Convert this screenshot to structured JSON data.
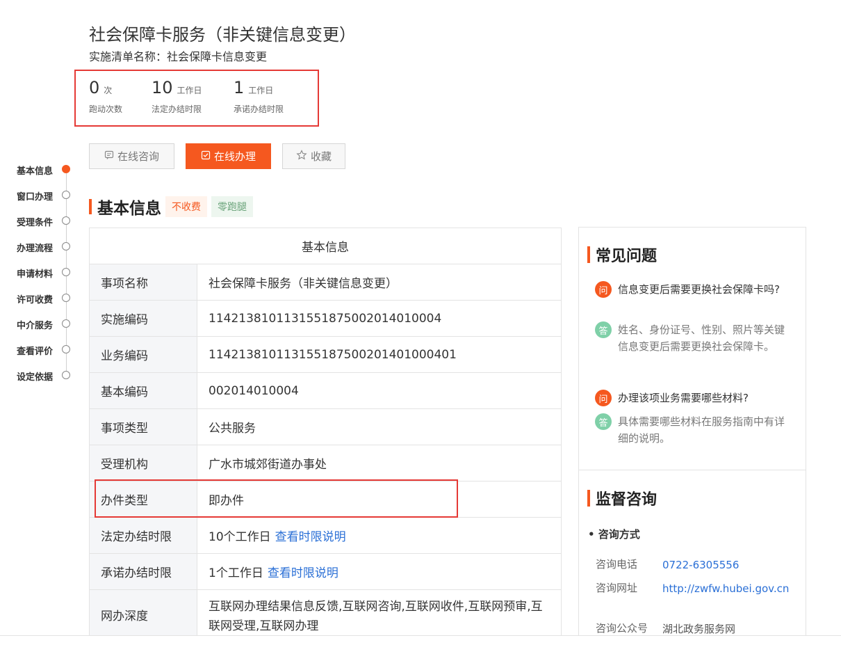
{
  "header": {
    "title": "社会保障卡服务（非关键信息变更）",
    "subtitle": "实施清单名称：社会保障卡信息变更"
  },
  "stats": [
    {
      "value": "0",
      "unit": "次",
      "label": "跑动次数"
    },
    {
      "value": "10",
      "unit": "工作日",
      "label": "法定办结时限"
    },
    {
      "value": "1",
      "unit": "工作日",
      "label": "承诺办结时限"
    }
  ],
  "actions": {
    "consult": "在线咨询",
    "handle": "在线办理",
    "favorite": "收藏"
  },
  "side_nav": [
    {
      "label": "基本信息",
      "active": true
    },
    {
      "label": "窗口办理",
      "active": false
    },
    {
      "label": "受理条件",
      "active": false
    },
    {
      "label": "办理流程",
      "active": false
    },
    {
      "label": "申请材料",
      "active": false
    },
    {
      "label": "许可收费",
      "active": false
    },
    {
      "label": "中介服务",
      "active": false
    },
    {
      "label": "查看评价",
      "active": false
    },
    {
      "label": "设定依据",
      "active": false
    }
  ],
  "section": {
    "title": "基本信息",
    "tags": [
      "不收费",
      "零跑腿"
    ]
  },
  "info_table": {
    "header": "基本信息",
    "rows": [
      {
        "key": "事项名称",
        "value": "社会保障卡服务（非关键信息变更）",
        "link": ""
      },
      {
        "key": "实施编码",
        "value": "11421381011315518750020140100​04",
        "link": ""
      },
      {
        "key": "业务编码",
        "value": "1142138101131551875002014010004​01",
        "link": ""
      },
      {
        "key": "基本编码",
        "value": "002014010004",
        "link": ""
      },
      {
        "key": "事项类型",
        "value": "公共服务",
        "link": ""
      },
      {
        "key": "受理机构",
        "value": "广水市城郊街道办事处",
        "link": ""
      },
      {
        "key": "办件类型",
        "value": "即办件",
        "link": ""
      },
      {
        "key": "法定办结时限",
        "value": "10个工作日",
        "link": "查看时限说明"
      },
      {
        "key": "承诺办结时限",
        "value": "1个工作日",
        "link": "查看时限说明"
      },
      {
        "key": "网办深度",
        "value": "互联网办理结果信息反馈,互联网咨询,互联网收件,互联网预审,互联网受理,互联网办理",
        "link": ""
      }
    ]
  },
  "faq": {
    "title": "常见问题",
    "q_badge": "问",
    "a_badge": "答",
    "items": [
      {
        "q": "信息变更后需要更换社会保障卡吗?",
        "a": "姓名、身份证号、性别、照片等关键信息变更后需要更换社会保障卡。"
      },
      {
        "q": "办理该项业务需要哪些材料?",
        "a": "具体需要哪些材料在服务指南中有详细的说明。"
      }
    ]
  },
  "supervision": {
    "title": "监督咨询",
    "contact_head": "• 咨询方式",
    "rows": [
      {
        "label": "咨询电话",
        "value": "0722-6305556"
      },
      {
        "label": "咨询网址",
        "value": "http://zwfw.hubei.gov.cn"
      },
      {
        "label": "咨询公众号",
        "value": "湖北政务服务网"
      }
    ]
  },
  "colors": {
    "accent": "#f5581f",
    "highlight_box": "#e53935",
    "link": "#2a6fd6",
    "answer_badge": "#7fd0a8"
  }
}
